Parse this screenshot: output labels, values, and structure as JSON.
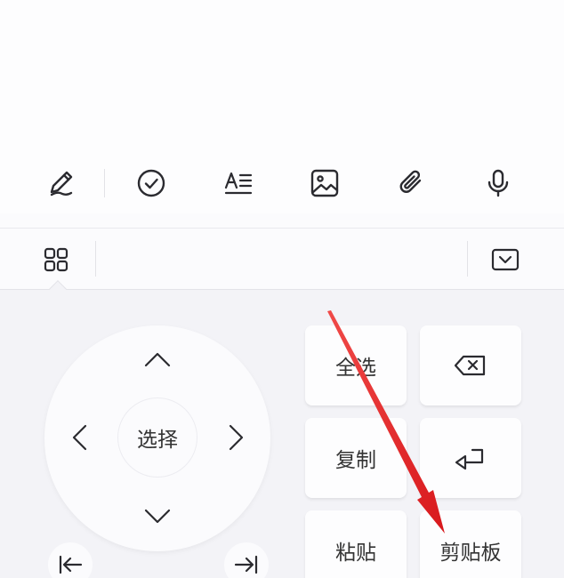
{
  "toolbar": {
    "icons": [
      "pen-icon",
      "check-circle-icon",
      "text-format-icon",
      "image-icon",
      "paperclip-icon",
      "microphone-icon"
    ]
  },
  "keyboard_bar": {
    "left_icon": "grid-icon",
    "right_icon": "collapse-keyboard-icon"
  },
  "edit_panel": {
    "select_label": "选择",
    "select_all_label": "全选",
    "copy_label": "复制",
    "paste_label": "粘贴",
    "clipboard_label": "剪贴板",
    "backspace_icon": "backspace-icon",
    "enter_icon": "enter-icon"
  },
  "colors": {
    "accent_arrow": "#e8262a",
    "icon": "#2b2b30",
    "panel_bg": "#f3f3f7"
  }
}
